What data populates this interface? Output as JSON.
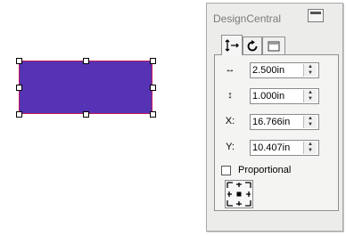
{
  "palette": {
    "title": "DesignCentral",
    "close_glyph": "✕",
    "tabs": [
      {
        "name": "size-position",
        "icon": "size-arrows-icon"
      },
      {
        "name": "rotate",
        "icon": "rotate-icon"
      },
      {
        "name": "box",
        "icon": "box-icon"
      }
    ],
    "fields": {
      "width": {
        "label": "↔",
        "value": "2.500in"
      },
      "height": {
        "label": "↕",
        "value": "1.000in"
      },
      "x": {
        "label": "X:",
        "value": "16.766in"
      },
      "y": {
        "label": "Y:",
        "value": "10.407in"
      }
    },
    "proportional": {
      "label": "Proportional",
      "checked": false
    }
  },
  "shape": {
    "fill": "#5633b4",
    "outline": "#c0185a",
    "selected": true
  }
}
